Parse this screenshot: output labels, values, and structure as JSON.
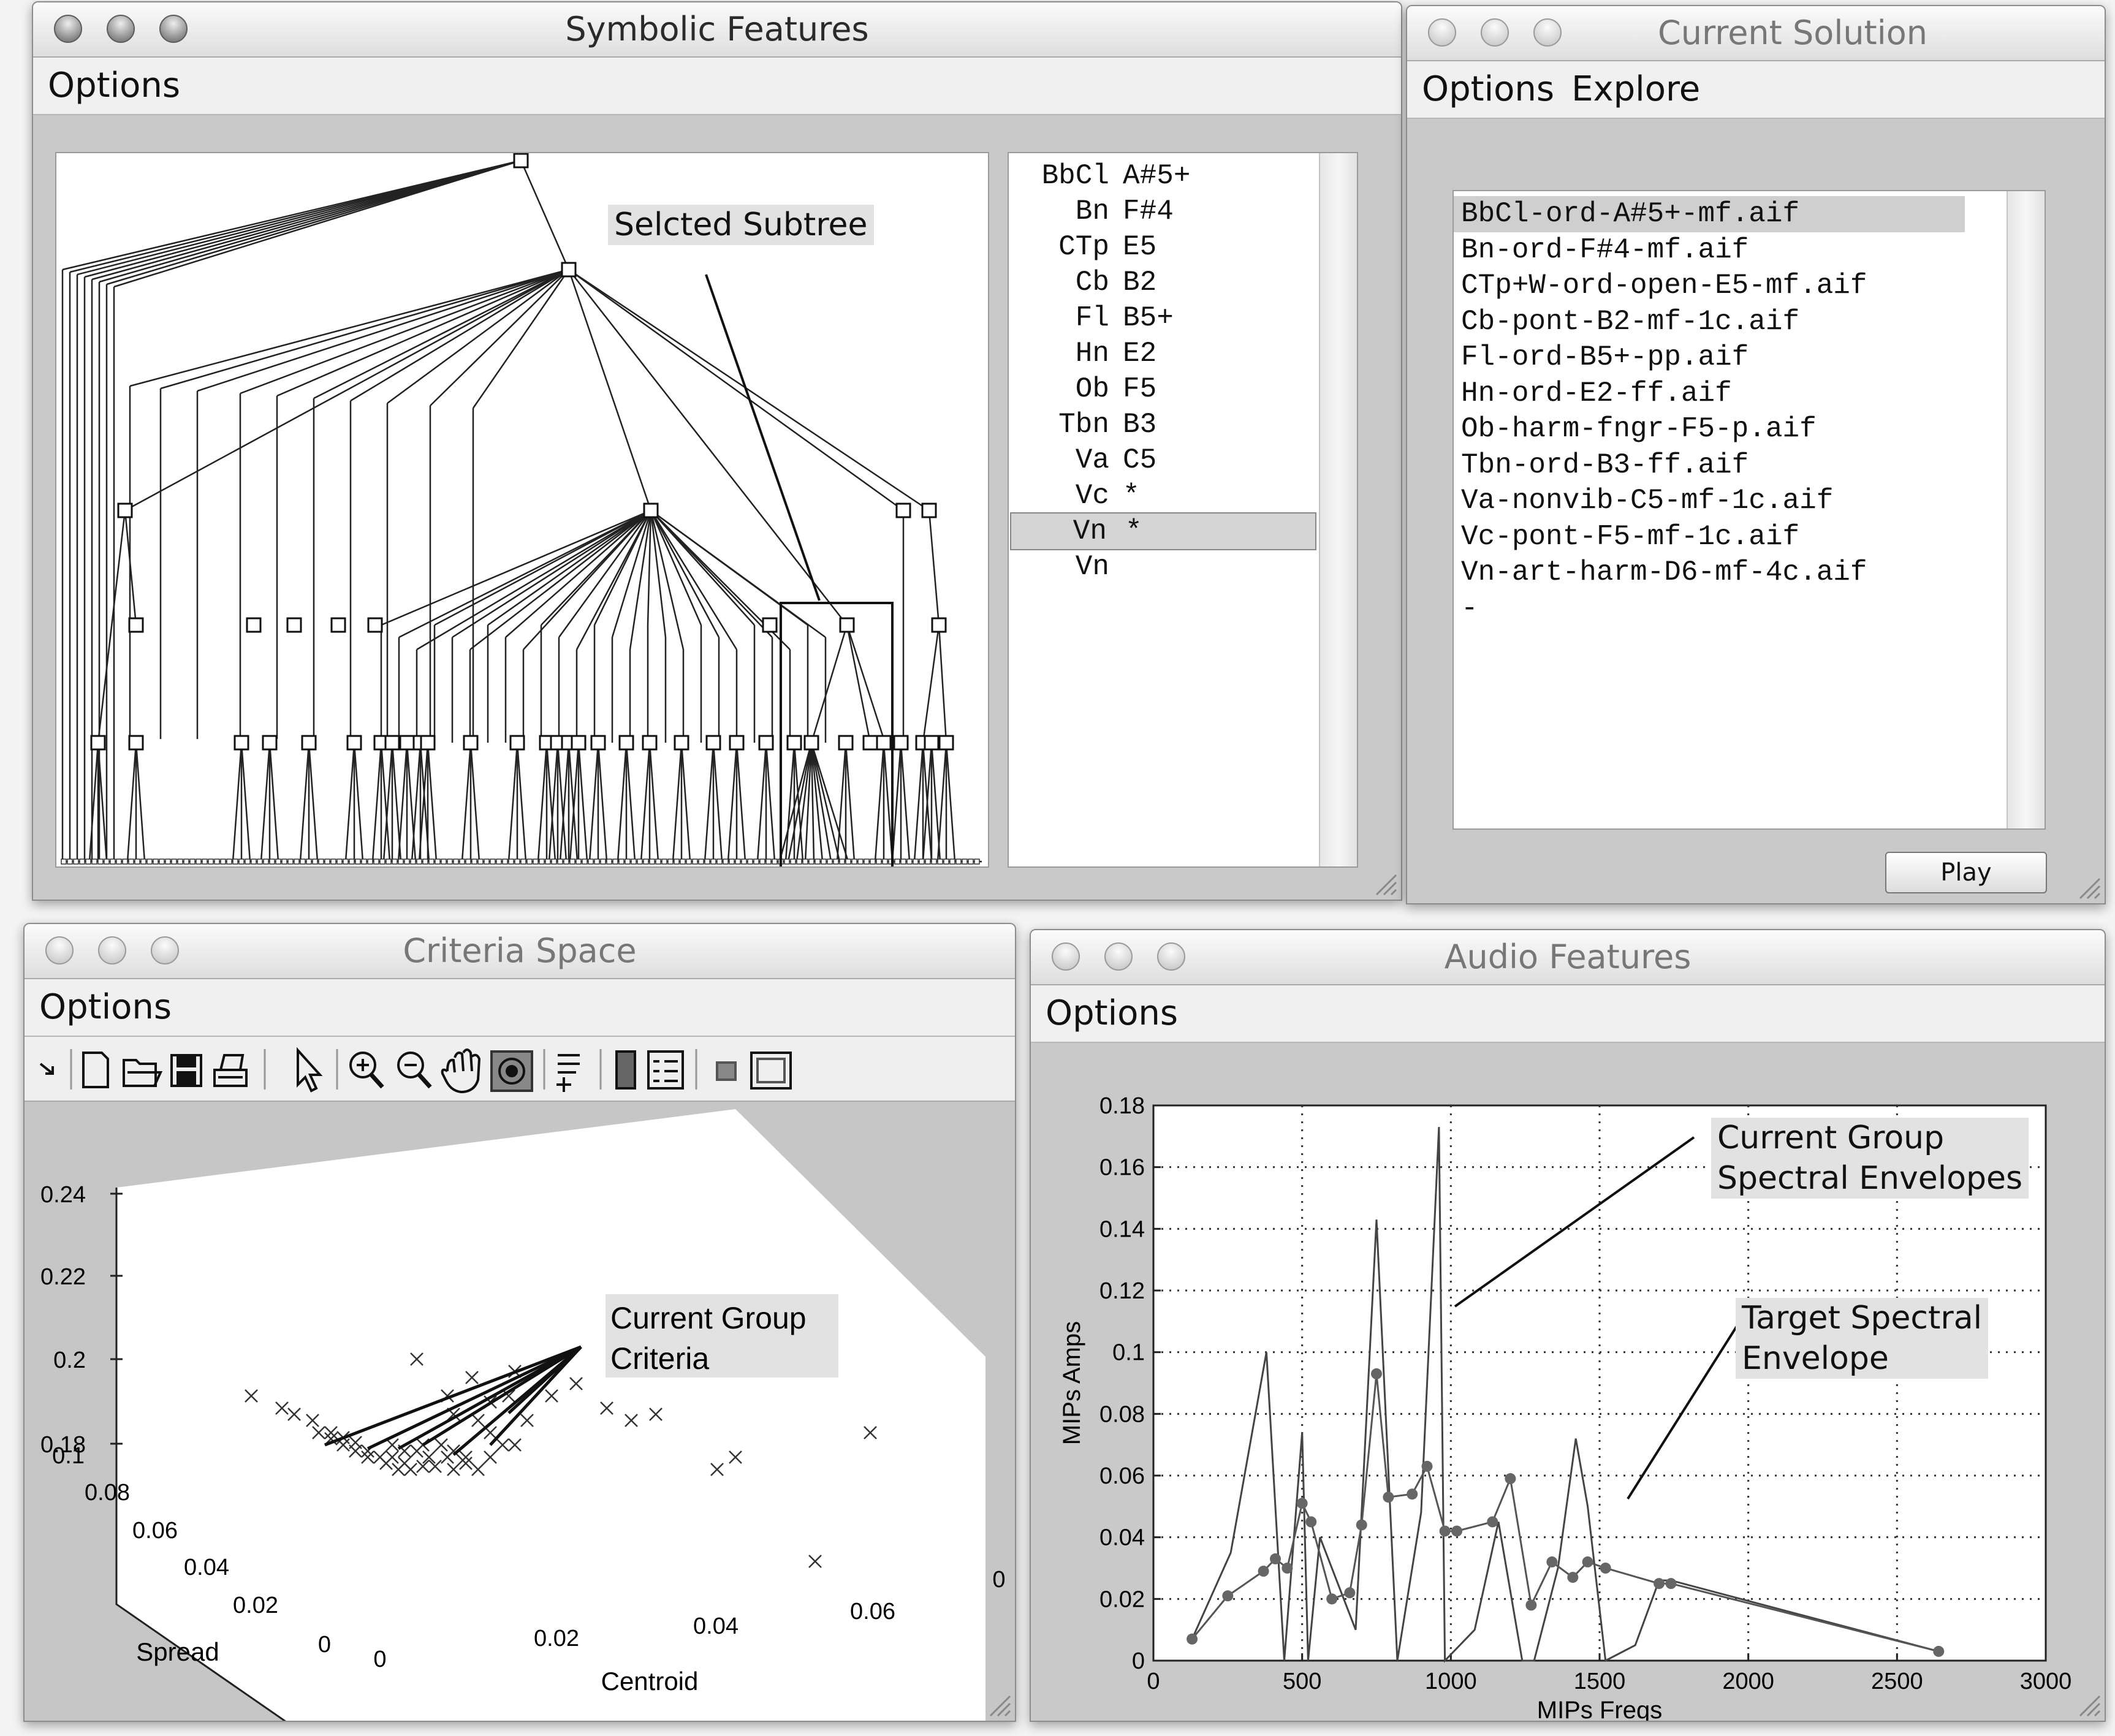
{
  "windows": {
    "symbolic": {
      "title": "Symbolic Features",
      "menu": [
        "Options"
      ],
      "annotation": "Selcted Subtree",
      "instruments": [
        {
          "inst": "BbCl",
          "note": "A#5+"
        },
        {
          "inst": "Bn",
          "note": "F#4"
        },
        {
          "inst": "CTp",
          "note": "E5"
        },
        {
          "inst": "Cb",
          "note": "B2"
        },
        {
          "inst": "Fl",
          "note": "B5+"
        },
        {
          "inst": "Hn",
          "note": "E2"
        },
        {
          "inst": "Ob",
          "note": "F5"
        },
        {
          "inst": "Tbn",
          "note": "B3"
        },
        {
          "inst": "Va",
          "note": "C5"
        },
        {
          "inst": "Vc",
          "note": "*"
        },
        {
          "inst": "Vn",
          "note": "*"
        },
        {
          "inst": "Vn",
          "note": ""
        }
      ],
      "selected_row": 10
    },
    "current_solution": {
      "title": "Current Solution",
      "menu": [
        "Options",
        "Explore"
      ],
      "files": [
        "BbCl-ord-A#5+-mf.aif",
        "Bn-ord-F#4-mf.aif",
        "CTp+W-ord-open-E5-mf.aif",
        "Cb-pont-B2-mf-1c.aif",
        "Fl-ord-B5+-pp.aif",
        "Hn-ord-E2-ff.aif",
        "Ob-harm-fngr-F5-p.aif",
        "Tbn-ord-B3-ff.aif",
        "Va-nonvib-C5-mf-1c.aif",
        "Vc-pont-F5-mf-1c.aif",
        "Vn-art-harm-D6-mf-4c.aif",
        "-"
      ],
      "selected_row": 0,
      "play_label": "Play"
    },
    "criteria": {
      "title": "Criteria Space",
      "menu": [
        "Options"
      ],
      "annotation_line1": "Current Group",
      "annotation_line2": "Criteria",
      "z_ticks": [
        "0.24",
        "0.22",
        "0.2",
        "0.18"
      ],
      "spread_ticks": [
        "0.1",
        "0.08",
        "0.06",
        "0.04",
        "0.02",
        "0"
      ],
      "centroid_ticks": [
        "0",
        "0.02",
        "0.04",
        "0.06",
        "0"
      ],
      "xlabel": "Centroid",
      "ylabel": "Spread",
      "toolbar_icons": [
        "arrow-icon",
        "new-file-icon",
        "open-folder-icon",
        "save-icon",
        "print-icon",
        "pointer-icon",
        "zoom-in-icon",
        "zoom-out-icon",
        "pan-hand-icon",
        "rotate-3d-icon",
        "data-cursor-icon",
        "colorbar-icon",
        "legend-icon",
        "hide-plot-tools-icon",
        "show-plot-tools-icon"
      ]
    },
    "audio": {
      "title": "Audio Features",
      "menu": [
        "Options"
      ],
      "annotation1_line1": "Current Group",
      "annotation1_line2": "Spectral Envelopes",
      "annotation2_line1": "Target Spectral",
      "annotation2_line2": "Envelope"
    }
  },
  "chart_data": {
    "type": "line",
    "xlabel": "MIPs Freqs",
    "ylabel": "MIPs Amps",
    "xlim": [
      0,
      3000
    ],
    "ylim": [
      0,
      0.18
    ],
    "xticks": [
      0,
      500,
      1000,
      1500,
      2000,
      2500,
      3000
    ],
    "yticks": [
      0,
      0.02,
      0.04,
      0.06,
      0.08,
      0.1,
      0.12,
      0.14,
      0.16,
      0.18
    ],
    "ytick_labels": [
      "0",
      "0.02",
      "0.04",
      "0.06",
      "0.08",
      "0.1",
      "0.12",
      "0.14",
      "0.16",
      "0.18"
    ],
    "grid": true,
    "series": [
      {
        "marker": "none",
        "x": [
          130,
          260,
          380,
          440,
          500,
          520,
          560,
          680,
          750,
          820,
          900,
          960,
          980,
          1080,
          1160,
          1240,
          1280,
          1360,
          1420,
          1460,
          1520,
          1620,
          1700,
          1740,
          2640
        ],
        "y": [
          0.007,
          0.035,
          0.1,
          0.0,
          0.074,
          0.0,
          0.04,
          0.01,
          0.143,
          0.0,
          0.048,
          0.173,
          0.0,
          0.01,
          0.045,
          0.0,
          0.0,
          0.03,
          0.072,
          0.05,
          0.0,
          0.005,
          0.026,
          0.026,
          0.003
        ]
      },
      {
        "marker": "dot",
        "x": [
          130,
          250,
          370,
          410,
          450,
          500,
          530,
          600,
          660,
          700,
          750,
          790,
          870,
          920,
          980,
          1020,
          1140,
          1200,
          1270,
          1340,
          1410,
          1460,
          1520,
          1700,
          1740,
          2640
        ],
        "y": [
          0.007,
          0.021,
          0.029,
          0.033,
          0.03,
          0.051,
          0.045,
          0.02,
          0.022,
          0.044,
          0.093,
          0.053,
          0.054,
          0.063,
          0.042,
          0.042,
          0.045,
          0.059,
          0.018,
          0.032,
          0.027,
          0.032,
          0.03,
          0.025,
          0.025,
          0.003
        ]
      }
    ]
  }
}
